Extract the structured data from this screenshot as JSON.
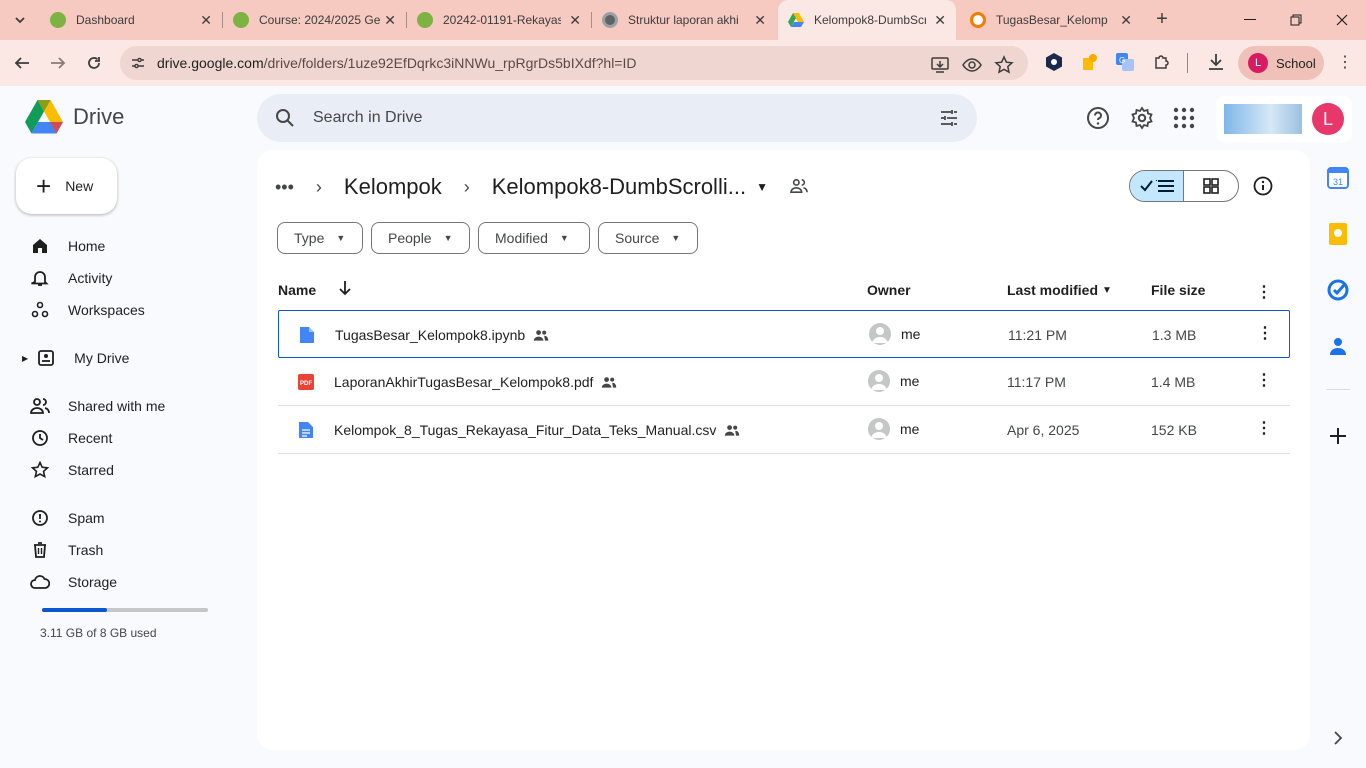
{
  "browser": {
    "tabs": [
      {
        "title": "Dashboard",
        "favicon_color": "#7cb342"
      },
      {
        "title": "Course: 2024/2025 Ge",
        "favicon_color": "#7cb342"
      },
      {
        "title": "20242-01191-Rekayas",
        "favicon_color": "#7cb342"
      },
      {
        "title": "Struktur laporan akhi",
        "favicon_color": "#5f6368"
      },
      {
        "title": "Kelompok8-DumbScr",
        "favicon_color": "#1a73e8",
        "active": true
      },
      {
        "title": "TugasBesar_Kelompo",
        "favicon_color": "#f57c00"
      }
    ],
    "url_host": "drive.google.com",
    "url_path": "/drive/folders/1uze92EfDqrkc3iNNWu_rpRgrDs5bIXdf?hl=ID",
    "profile_initial": "L",
    "profile_label": "School"
  },
  "drive": {
    "logo_text": "Drive",
    "search_placeholder": "Search in Drive",
    "new_label": "New",
    "account_initial": "L",
    "nav": [
      {
        "label": "Home",
        "icon": "home-icon"
      },
      {
        "label": "Activity",
        "icon": "bell-icon"
      },
      {
        "label": "Workspaces",
        "icon": "workspaces-icon"
      },
      {
        "label": "My Drive",
        "icon": "my-drive-icon"
      },
      {
        "label": "Shared with me",
        "icon": "shared-icon"
      },
      {
        "label": "Recent",
        "icon": "clock-icon"
      },
      {
        "label": "Starred",
        "icon": "star-icon"
      },
      {
        "label": "Spam",
        "icon": "spam-icon"
      },
      {
        "label": "Trash",
        "icon": "trash-icon"
      },
      {
        "label": "Storage",
        "icon": "cloud-icon"
      }
    ],
    "storage": {
      "text": "3.11 GB of 8 GB used",
      "used_fraction": 0.39
    },
    "breadcrumb": {
      "parent": "Kelompok",
      "current": "Kelompok8-DumbScrolli..."
    },
    "filters": [
      "Type",
      "People",
      "Modified",
      "Source"
    ],
    "columns": {
      "name": "Name",
      "owner": "Owner",
      "modified": "Last modified",
      "size": "File size"
    },
    "files": [
      {
        "name": "TugasBesar_Kelompok8.ipynb",
        "type": "notebook",
        "owner": "me",
        "modified": "11:21 PM",
        "size": "1.3 MB"
      },
      {
        "name": "LaporanAkhirTugasBesar_Kelompok8.pdf",
        "type": "pdf",
        "owner": "me",
        "modified": "11:17 PM",
        "size": "1.4 MB"
      },
      {
        "name": "Kelompok_8_Tugas_Rekayasa_Fitur_Data_Teks_Manual.csv",
        "type": "doc",
        "owner": "me",
        "modified": "Apr 6, 2025",
        "size": "152 KB"
      }
    ],
    "pdf_badge": "PDF",
    "calendar_day": "31"
  }
}
